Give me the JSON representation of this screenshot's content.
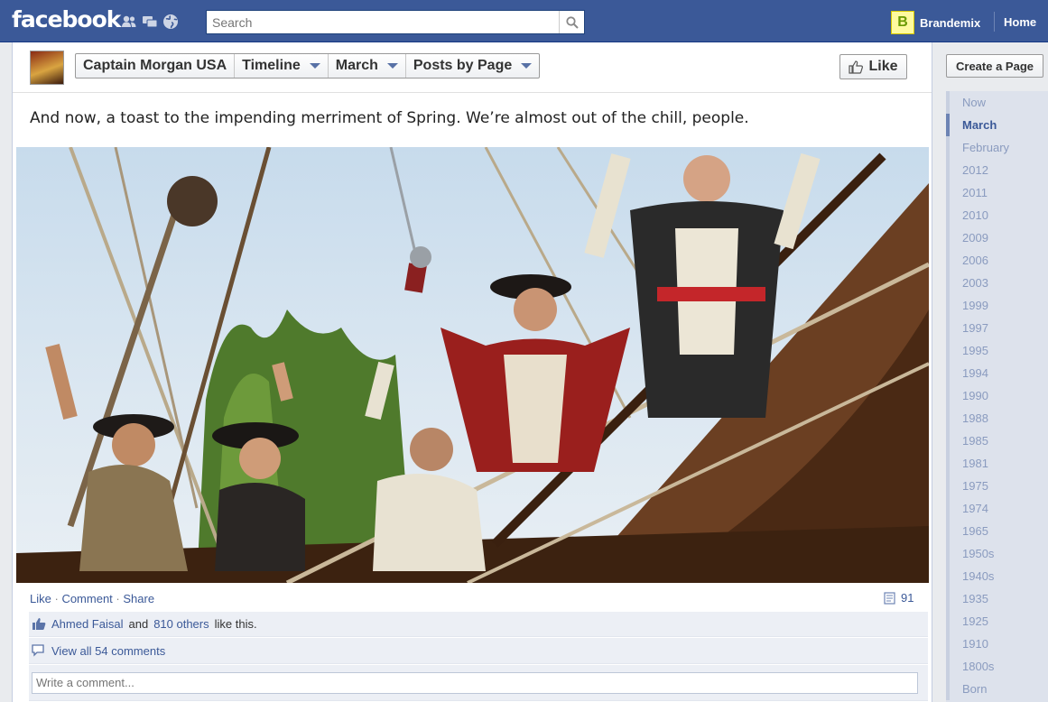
{
  "topbar": {
    "logo": "facebook",
    "search_placeholder": "Search",
    "user_name": "Brandemix",
    "home": "Home"
  },
  "page": {
    "crumbs": [
      {
        "label": "Captain Morgan USA",
        "dropdown": false
      },
      {
        "label": "Timeline",
        "dropdown": true
      },
      {
        "label": "March",
        "dropdown": true
      },
      {
        "label": "Posts by Page",
        "dropdown": true
      }
    ],
    "like_button": "Like"
  },
  "post": {
    "status_text": "And now, a toast to the impending merriment of Spring. We’re almost out of the chill, people.",
    "actions": {
      "like": "Like",
      "comment": "Comment",
      "share": "Share"
    },
    "comment_count": "91",
    "likes": {
      "name": "Ahmed Faisal",
      "and": "and",
      "others": "810 others",
      "suffix": "like this."
    },
    "view_comments": "View all 54 comments",
    "comment_placeholder": "Write a comment..."
  },
  "sidebar": {
    "create_page": "Create a Page",
    "timeline": [
      "Now",
      "March",
      "February",
      "2012",
      "2011",
      "2010",
      "2009",
      "2006",
      "2003",
      "1999",
      "1997",
      "1995",
      "1994",
      "1990",
      "1988",
      "1985",
      "1981",
      "1975",
      "1974",
      "1965",
      "1950s",
      "1940s",
      "1935",
      "1925",
      "1910",
      "1800s",
      "Born"
    ],
    "active": "March"
  },
  "colors": {
    "brand": "#3b5998",
    "link": "#3b5998",
    "ufi_bg": "#eceff5"
  }
}
